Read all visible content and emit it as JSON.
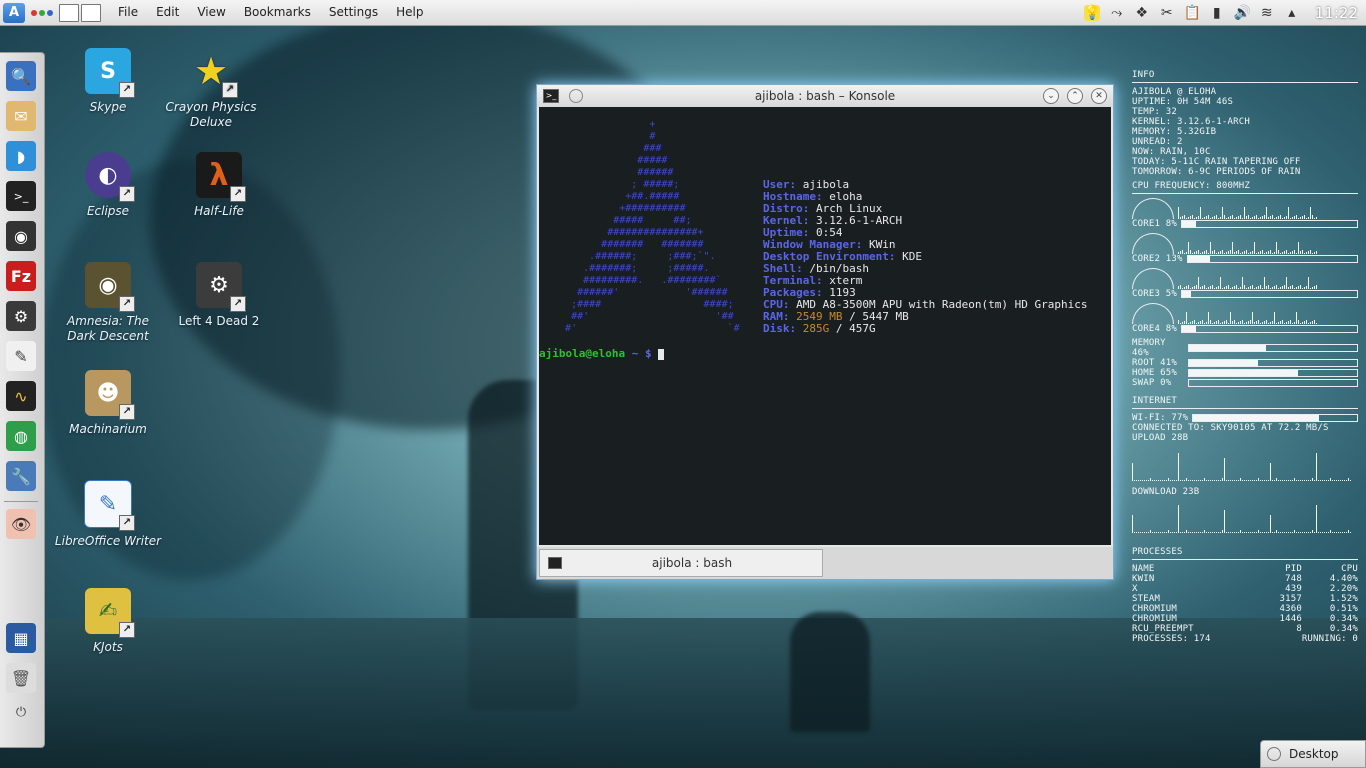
{
  "menubar": {
    "items": [
      "File",
      "Edit",
      "View",
      "Bookmarks",
      "Settings",
      "Help"
    ],
    "clock": "11:22",
    "tray_icons": [
      "bulb-icon",
      "network-tool-icon",
      "dropbox-icon",
      "scissors-icon",
      "clipboard-icon",
      "battery-icon",
      "volume-icon",
      "wifi-icon",
      "arrow-up-icon"
    ]
  },
  "desktop_icons": [
    {
      "label": "Skype",
      "icon": "skype-icon",
      "color": "#2aa6e0",
      "glyph": "S"
    },
    {
      "label": "Crayon Physics Deluxe",
      "icon": "star-icon",
      "color": "#f0d020",
      "glyph": "★"
    },
    {
      "label": "Eclipse",
      "icon": "eclipse-icon",
      "color": "#4a3c8e",
      "glyph": "◐"
    },
    {
      "label": "Half-Life",
      "icon": "lambda-icon",
      "color": "#c24a10",
      "glyph": "λ"
    },
    {
      "label": "Amnesia: The Dark Descent",
      "icon": "amnesia-icon",
      "color": "#5a5230",
      "glyph": "◉"
    },
    {
      "label": "Left 4 Dead 2",
      "icon": "steam-icon",
      "color": "#3c3c3c",
      "glyph": "⚙"
    },
    {
      "label": "Machinarium",
      "icon": "robot-icon",
      "color": "#b89860",
      "glyph": "☻"
    },
    {
      "label": "LibreOffice Writer",
      "icon": "writer-icon",
      "color": "#3a76c4",
      "glyph": "✎"
    },
    {
      "label": "KJots",
      "icon": "notepad-icon",
      "color": "#e0c040",
      "glyph": "✍"
    }
  ],
  "konsole": {
    "title": "ajibola : bash – Konsole",
    "tab": "ajibola : bash",
    "logo": "                 +\n                 #\n                ###\n               #####\n               ######\n              ; #####;\n             +##.#####\n            +##########\n           #####     ##;\n          ###############+\n         #######   #######\n       .######;     ;###;`\".\n      .#######;     ;#####.\n      #########.   .########`\n     ######'           '######\n    ;####                 ####;\n    ##'                     '##\n   #'                         `#",
    "info": [
      {
        "key": "User:",
        "value": " ajibola"
      },
      {
        "key": "Hostname:",
        "value": " eloha"
      },
      {
        "key": "Distro:",
        "value": " Arch Linux"
      },
      {
        "key": "Kernel:",
        "value": " 3.12.6-1-ARCH"
      },
      {
        "key": "Uptime:",
        "value": " 0:54"
      },
      {
        "key": "Window Manager:",
        "value": " KWin"
      },
      {
        "key": "Desktop Environment:",
        "value": " KDE"
      },
      {
        "key": "Shell:",
        "value": " /bin/bash"
      },
      {
        "key": "Terminal:",
        "value": " xterm"
      },
      {
        "key": "Packages:",
        "value": " 1193"
      },
      {
        "key": "CPU:",
        "value": " AMD A8-3500M APU with Radeon(tm) HD Graphics"
      },
      {
        "key": "RAM:",
        "value": "",
        "hl": " 2549 MB",
        "rest": " / 5447 MB"
      },
      {
        "key": "Disk:",
        "value": "",
        "hl": " 285G",
        "rest": " / 457G"
      }
    ],
    "prompt_user": "ajibola@eloha",
    "prompt_path": " ~ $ "
  },
  "conky": {
    "info_header": "INFO",
    "info_lines": [
      "AJIBOLA @ ELOHA",
      "UPTIME: 0H 54M 46S",
      "TEMP:   32",
      "KERNEL: 3.12.6-1-ARCH",
      "MEMORY: 5.32GIB",
      "UNREAD: 2",
      "NOW: RAIN, 10C",
      "TODAY: 5-11C RAIN TAPERING OFF",
      "TOMORROW: 6-9C PERIODS OF RAIN"
    ],
    "cpu_header": "CPU FREQUENCY: 800MHZ",
    "cores": [
      {
        "label": "CORE1 8%",
        "value": 8
      },
      {
        "label": "CORE2 13%",
        "value": 13
      },
      {
        "label": "CORE3 5%",
        "value": 5
      },
      {
        "label": "CORE4 8%",
        "value": 8
      }
    ],
    "usage": [
      {
        "label": "MEMORY 46%",
        "value": 46
      },
      {
        "label": "ROOT 41%",
        "value": 41
      },
      {
        "label": "HOME 65%",
        "value": 65
      },
      {
        "label": "SWAP 0%",
        "value": 0
      }
    ],
    "internet_header": "INTERNET",
    "wifi": {
      "label": "WI-FI: 77%",
      "value": 77
    },
    "connected": "CONNECTED TO: SKY90105 AT 72.2 MB/S",
    "upload": "UPLOAD 28B",
    "download": "DOWNLOAD 23B",
    "processes_header": "PROCESSES",
    "proc_columns": [
      "NAME",
      "PID",
      "CPU"
    ],
    "processes": [
      {
        "name": "KWIN",
        "pid": "748",
        "cpu": "4.40%"
      },
      {
        "name": "X",
        "pid": "439",
        "cpu": "2.20%"
      },
      {
        "name": "STEAM",
        "pid": "3157",
        "cpu": "1.52%"
      },
      {
        "name": "CHROMIUM",
        "pid": "4360",
        "cpu": "0.51%"
      },
      {
        "name": "CHROMIUM",
        "pid": "1446",
        "cpu": "0.34%"
      },
      {
        "name": "RCU_PREEMPT",
        "pid": "8",
        "cpu": "0.34%"
      }
    ],
    "proc_total": "PROCESSES: 174",
    "proc_running": "RUNNING: 0"
  },
  "desktop_button": "Desktop"
}
